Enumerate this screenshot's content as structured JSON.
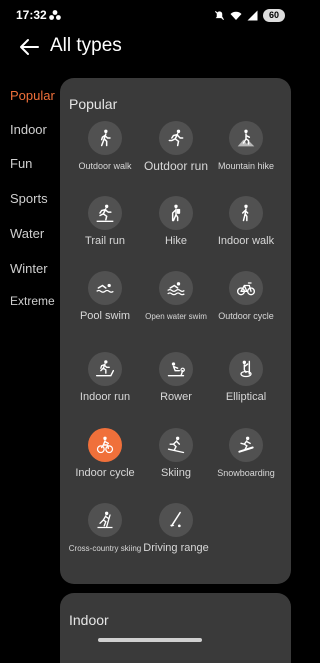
{
  "status": {
    "time": "17:32",
    "battery": "60"
  },
  "header": {
    "title": "All types"
  },
  "sidebar": {
    "items": [
      {
        "label": "Popular",
        "active": true
      },
      {
        "label": "Indoor",
        "active": false
      },
      {
        "label": "Fun",
        "active": false
      },
      {
        "label": "Sports",
        "active": false
      },
      {
        "label": "Water",
        "active": false
      },
      {
        "label": "Winter",
        "active": false
      },
      {
        "label": "Extreme",
        "active": false
      }
    ]
  },
  "popular": {
    "title": "Popular",
    "tiles": [
      {
        "label": "Outdoor walk",
        "icon": "walk-icon"
      },
      {
        "label": "Outdoor run",
        "icon": "run-icon"
      },
      {
        "label": "Mountain hike",
        "icon": "mountain-hike-icon"
      },
      {
        "label": "Trail run",
        "icon": "trail-run-icon"
      },
      {
        "label": "Hike",
        "icon": "hike-icon"
      },
      {
        "label": "Indoor walk",
        "icon": "indoor-walk-icon"
      },
      {
        "label": "Pool swim",
        "icon": "pool-swim-icon"
      },
      {
        "label": "Open water swim",
        "icon": "open-water-swim-icon"
      },
      {
        "label": "Outdoor cycle",
        "icon": "bicycle-icon"
      },
      {
        "label": "Indoor run",
        "icon": "treadmill-icon"
      },
      {
        "label": "Rower",
        "icon": "rower-icon"
      },
      {
        "label": "Elliptical",
        "icon": "elliptical-icon"
      },
      {
        "label": "Indoor cycle",
        "icon": "indoor-cycle-icon",
        "selected": true
      },
      {
        "label": "Skiing",
        "icon": "skiing-icon"
      },
      {
        "label": "Snowboarding",
        "icon": "snowboard-icon"
      },
      {
        "label": "Cross-country skiing",
        "icon": "cross-country-ski-icon"
      },
      {
        "label": "Driving range",
        "icon": "golf-icon"
      }
    ]
  },
  "indoor": {
    "title": "Indoor"
  },
  "colors": {
    "accent": "#f0703a",
    "card": "#3a3a3a",
    "tile_circle": "#515151"
  }
}
